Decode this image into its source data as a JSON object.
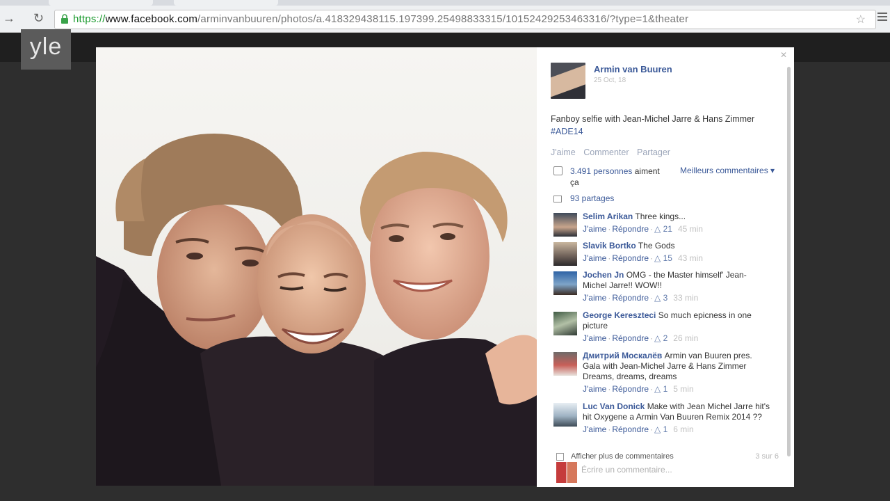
{
  "browser": {
    "url_scheme": "https://",
    "url_host": "www.facebook.com",
    "url_path": "/arminvanbuuren/photos/a.418329438115.197399.25498833315/10152429253463316/?type=1&theater"
  },
  "branding": {
    "yle": "yle"
  },
  "post": {
    "author": "Armin van Buuren",
    "date": "25 Oct, 18",
    "text": "Fanboy selfie with Jean-Michel Jarre & Hans Zimmer",
    "hashtag": "#ADE14",
    "actions": [
      "J'aime",
      "Commenter",
      "Partager"
    ],
    "likes_count": "3.491 personnes",
    "likes_suffix": "aiment ça",
    "best_comments": "Meilleurs commentaires ▾",
    "shares": "93 partages"
  },
  "comments": [
    {
      "name": "Selim Arikan",
      "text": "Three kings...",
      "like": "J'aime",
      "reply": "Répondre",
      "likes": "21",
      "time": "45 min"
    },
    {
      "name": "Slavik Bortko",
      "text": "The Gods",
      "like": "J'aime",
      "reply": "Répondre",
      "likes": "15",
      "time": "43 min"
    },
    {
      "name": "Jochen Jn",
      "text": "OMG - the Master himself' Jean-Michel Jarre!! WOW!!",
      "like": "J'aime",
      "reply": "Répondre",
      "likes": "3",
      "time": "33 min"
    },
    {
      "name": "George Kereszteci",
      "text": "So much epicness in one picture",
      "like": "J'aime",
      "reply": "Répondre",
      "likes": "2",
      "time": "26 min"
    },
    {
      "name": "Дмитрий Москалёв",
      "text": "Armin van Buuren pres. Gala with Jean-Michel Jarre & Hans Zimmer Dreams, dreams, dreams",
      "like": "J'aime",
      "reply": "Répondre",
      "likes": "1",
      "time": "5 min"
    },
    {
      "name": "Luc Van Donick",
      "text": "Make with Jean Michel Jarre hit's hit Oxygene a Armin Van Buuren Remix 2014 ??",
      "like": "J'aime",
      "reply": "Répondre",
      "likes": "1",
      "time": "6 min"
    }
  ],
  "footer": {
    "more_comments": "Afficher plus de commentaires",
    "more_count": "3 sur 6",
    "write_placeholder": "Écrire un commentaire..."
  },
  "colors": {
    "link": "#3b5998",
    "theater_bg": "#2e2e2e"
  },
  "icons": [
    "reload-icon",
    "lock-icon",
    "star-icon",
    "menu-icon",
    "close-icon",
    "thumb-icon",
    "share-icon"
  ]
}
